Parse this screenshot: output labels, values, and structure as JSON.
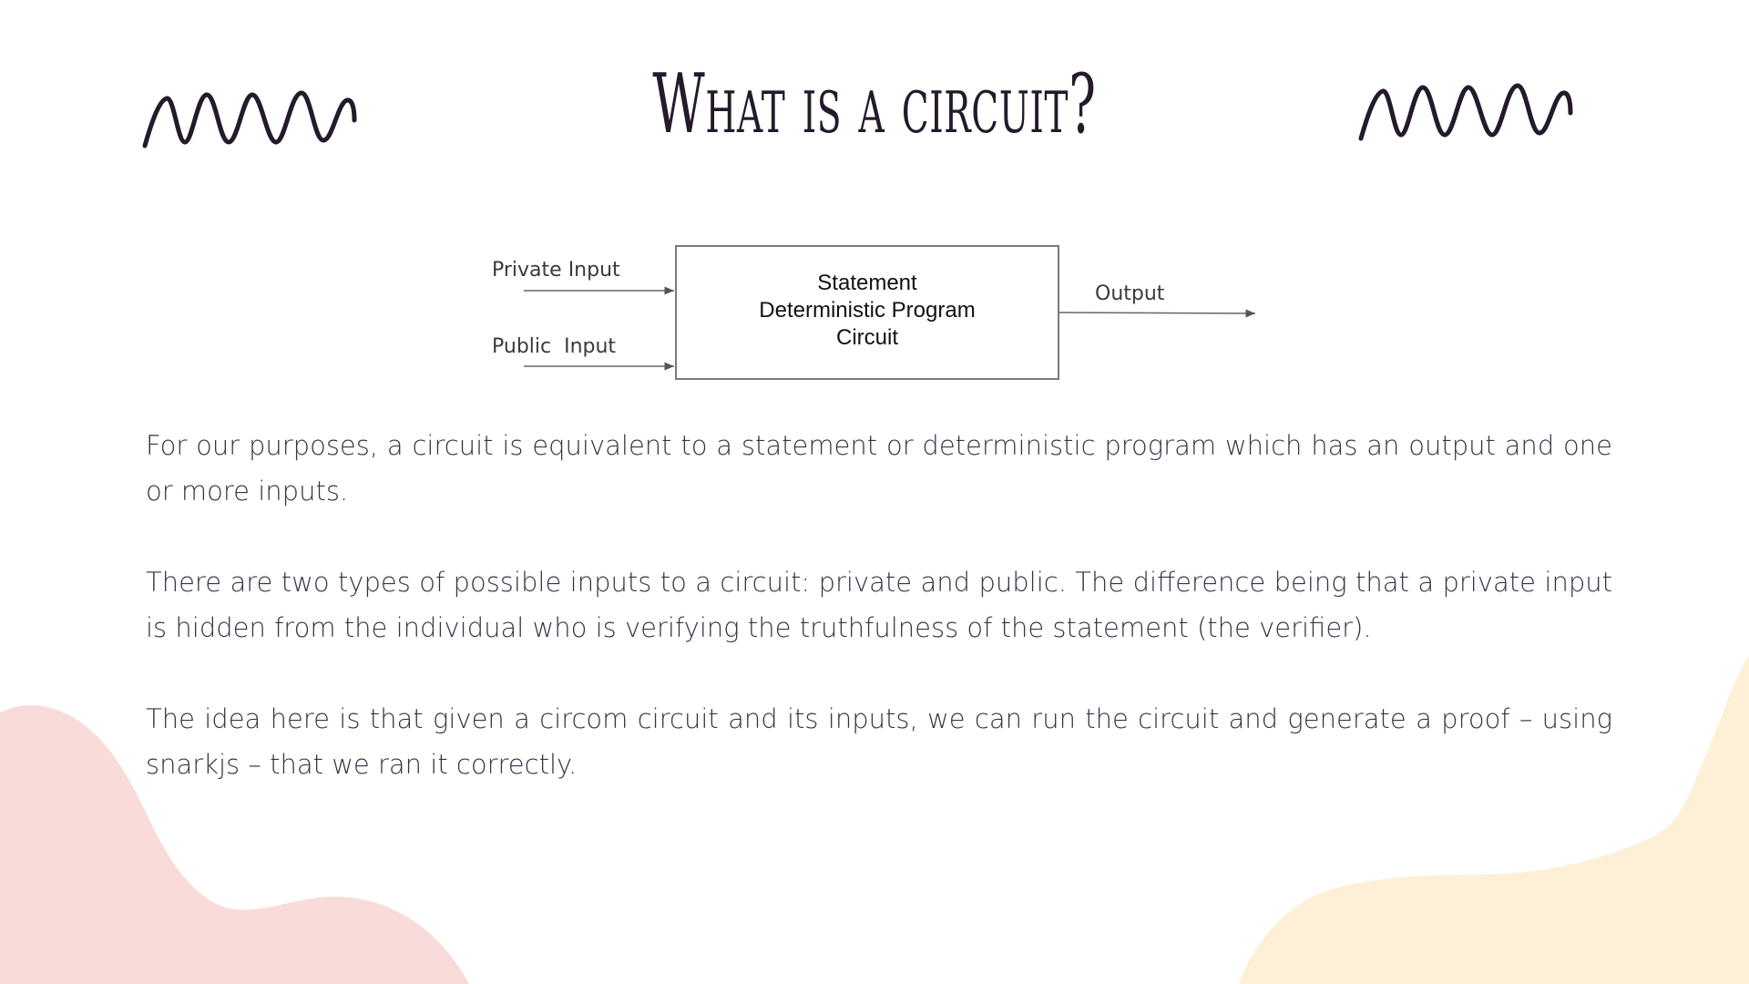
{
  "slide": {
    "title": "What is a circuit?",
    "diagram": {
      "private_input_label": "Private Input",
      "public_input_label": "Public  Input",
      "box_lines": [
        "Statement",
        "Deterministic Program",
        "Circuit"
      ],
      "output_label": "Output"
    },
    "paragraphs": [
      "For our purposes, a circuit is equivalent to a statement or deterministic program which has an output and one or more inputs.",
      "There are two types of possible inputs to a circuit: private and public. The difference being that a private input is hidden from the individual who is verifying the truthfulness of the statement (the verifier).",
      "The idea here is that given a circom circuit and its inputs, we can run the circuit and generate a proof – using snarkjs – that we ran it correctly."
    ]
  },
  "decorations": {
    "squiggle_icon": "squiggle-icon",
    "blob_left_color": "#f9dcd9",
    "blob_right_color": "#fdf0d6",
    "ink_color": "#241a2b"
  }
}
